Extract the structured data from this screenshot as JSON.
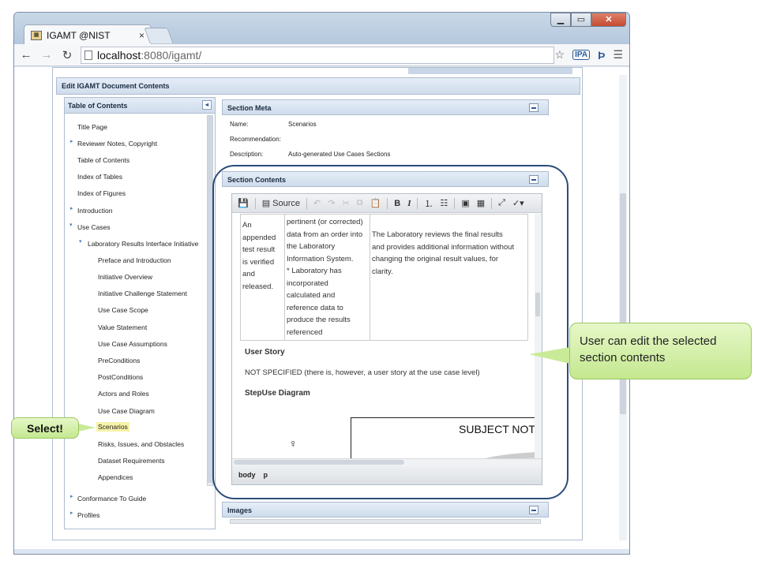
{
  "browser": {
    "tab_title": "IGAMT @NIST",
    "tab_close": "×",
    "url_host": "localhost",
    "url_path": ":8080/igamt/",
    "window_min": "▁",
    "window_max": "▭",
    "window_close": "✕"
  },
  "app": {
    "edit_header": "Edit IGAMT Document Contents"
  },
  "toc": {
    "title": "Table of Contents",
    "collapse": "◂",
    "items": [
      {
        "label": "Title Page"
      },
      {
        "label": "Reviewer Notes, Copyright"
      },
      {
        "label": "Table of Contents"
      },
      {
        "label": "Index of Tables"
      },
      {
        "label": "Index of Figures"
      },
      {
        "label": "Introduction"
      },
      {
        "label": "Use Cases"
      },
      {
        "label": "Laboratory Results Interface Initiative"
      },
      {
        "label": "Preface and Introduction"
      },
      {
        "label": "Initiative Overview"
      },
      {
        "label": "Initiative Challenge Statement"
      },
      {
        "label": "Use Case Scope"
      },
      {
        "label": "Value Statement"
      },
      {
        "label": "Use Case Assumptions"
      },
      {
        "label": "PreConditions"
      },
      {
        "label": "PostConditions"
      },
      {
        "label": "Actors and Roles"
      },
      {
        "label": "Use Case Diagram"
      },
      {
        "label": "Scenarios"
      },
      {
        "label": "Risks, Issues, and Obstacles"
      },
      {
        "label": "Dataset Requirements"
      },
      {
        "label": "Appendices"
      },
      {
        "label": "Conformance To Guide"
      },
      {
        "label": "Profiles"
      }
    ]
  },
  "meta": {
    "title": "Section Meta",
    "name_label": "Name:",
    "name_value": "Scenarios",
    "recommendation_label": "Recommendation:",
    "recommendation_value": "",
    "description_label": "Description:",
    "description_value": "Auto-generated Use Cases Sections"
  },
  "contents": {
    "title": "Section Contents",
    "toolbar": {
      "source": "Source"
    },
    "table": {
      "col1": [
        "An",
        "appended",
        "test result",
        "is verified",
        "and",
        "released."
      ],
      "col2": [
        "pertinent (or corrected)",
        "data from an order into",
        "the Laboratory",
        "Information System.",
        "* Laboratory has",
        "incorporated",
        "calculated and",
        "reference data to",
        "produce the results",
        "referenced"
      ],
      "col3": [
        "The Laboratory reviews the final results",
        "and provides additional information without",
        "changing the original result values, for",
        "clarity."
      ]
    },
    "user_story_heading": "User Story",
    "user_story_text": "NOT SPECIFIED (there is, however, a user story at the use case level)",
    "step_heading": "StepUse Diagram",
    "diagram_title": "SUBJECT NOT S",
    "status_body": "body",
    "status_p": "p"
  },
  "images_panel": {
    "title": "Images"
  },
  "annotations": {
    "callout_text": "User can edit the selected section contents",
    "select_text": "Select!",
    "ring_color": "#2b4d7a",
    "callout_color": "#c4e88f"
  }
}
